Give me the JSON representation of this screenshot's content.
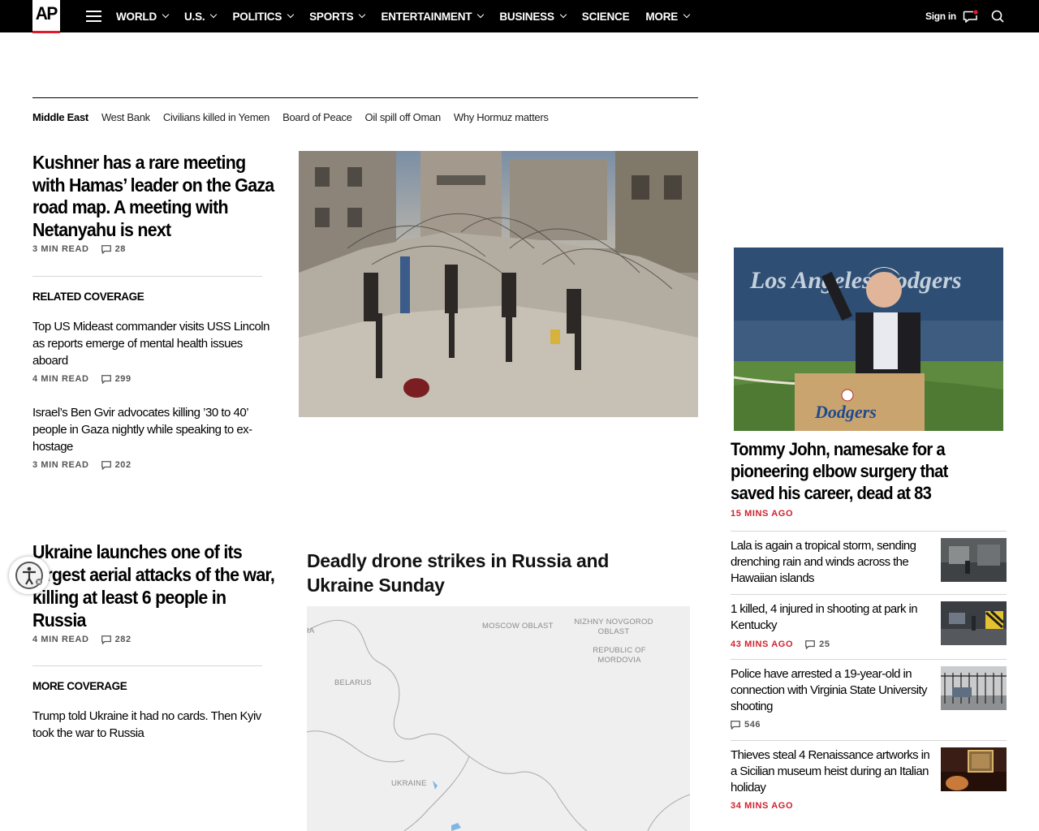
{
  "nav": {
    "logo": "AP",
    "items": [
      "WORLD",
      "U.S.",
      "POLITICS",
      "SPORTS",
      "ENTERTAINMENT",
      "BUSINESS",
      "SCIENCE",
      "MORE"
    ],
    "has_dropdown": [
      true,
      true,
      true,
      true,
      true,
      true,
      false,
      true
    ],
    "signin": "Sign in"
  },
  "topics": [
    "Middle East",
    "West Bank",
    "Civilians killed in Yemen",
    "Board of Peace",
    "Oil spill off Oman",
    "Why Hormuz matters"
  ],
  "lead": {
    "headline": "Kushner has a rare meeting with Hamas’ leader on the Gaza road map. A meeting with Netanyahu is next",
    "read": "3 MIN READ",
    "comments": "28",
    "related_label": "RELATED COVERAGE",
    "related": [
      {
        "title": "Top US Mideast commander visits USS Lincoln as reports emerge of mental health issues aboard",
        "read": "4 MIN READ",
        "comments": "299"
      },
      {
        "title": "Israel’s Ben Gvir advocates killing ’30 to 40’ people in Gaza nightly while speaking to ex-hostage",
        "read": "3 MIN READ",
        "comments": "202"
      }
    ]
  },
  "second": {
    "headline": "Ukraine launches one of its largest aerial attacks of the war, killing at least 6 people in Russia",
    "read": "4 MIN READ",
    "comments": "282",
    "more_label": "MORE COVERAGE",
    "more": [
      {
        "title": "Trump told Ukraine it had no cards. Then Kyiv took the war to Russia"
      }
    ]
  },
  "map": {
    "title": "Deadly drone strikes in Russia and Ukraine Sunday",
    "labels": [
      "MOSCOW OBLAST",
      "NIZHNY NOVGOROD OBLAST",
      "REPUBLIC OF MORDOVIA",
      "BELARUS",
      "UKRAINE"
    ]
  },
  "right": {
    "headline": "Tommy John, namesake for a pioneering elbow surgery that saved his career, dead at 83",
    "time": "15 MINS AGO",
    "items": [
      {
        "title": "Lala is again a tropical storm, sending drenching rain and winds across the Hawaiian islands",
        "time": "",
        "comments": ""
      },
      {
        "title": "1 killed, 4 injured in shooting at park in Kentucky",
        "time": "43 MINS AGO",
        "comments": "25"
      },
      {
        "title": "Police have arrested a 19-year-old in connection with Virginia State University shooting",
        "time": "",
        "comments": "546"
      },
      {
        "title": "Thieves steal 4 Renaissance artworks in a Sicilian museum heist during an Italian holiday",
        "time": "34 MINS AGO",
        "comments": ""
      }
    ]
  },
  "colors": {
    "accent_red": "#d0232e",
    "nav_bg": "#000000"
  }
}
